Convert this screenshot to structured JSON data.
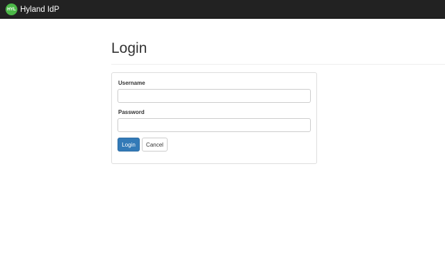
{
  "navbar": {
    "logo_text": "HYL",
    "brand_name": "Hyland IdP",
    "logo_color": "#4cb848",
    "background_color": "#222222"
  },
  "page": {
    "title": "Login"
  },
  "form": {
    "username_label": "Username",
    "username_value": "",
    "username_placeholder": "",
    "password_label": "Password",
    "password_value": "",
    "password_placeholder": "",
    "login_button": "Login",
    "cancel_button": "Cancel",
    "primary_color": "#337ab7"
  }
}
